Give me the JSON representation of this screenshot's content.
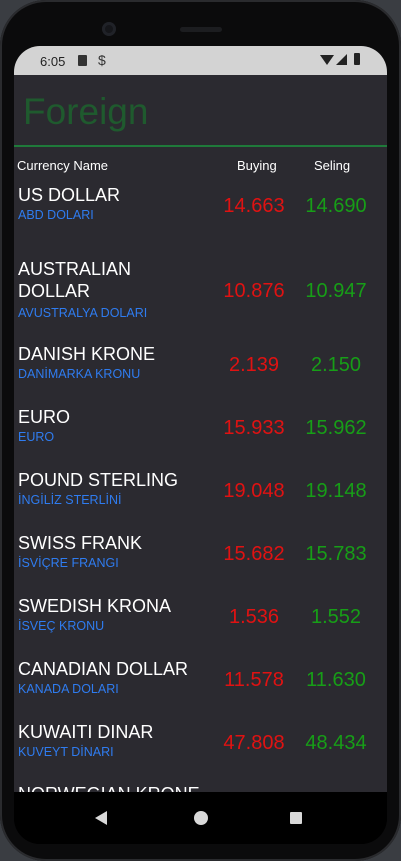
{
  "status": {
    "time": "6:05"
  },
  "app": {
    "title": "Foreign"
  },
  "columns": {
    "name": "Currency Name",
    "buying": "Buying",
    "selling": "Seling"
  },
  "currencies": [
    {
      "name": "US DOLLAR",
      "local_name": "ABD DOLARI",
      "buying": "14.663",
      "selling": "14.690"
    },
    {
      "name": "AUSTRALIAN DOLLAR",
      "local_name": "AVUSTRALYA DOLARI",
      "buying": "10.876",
      "selling": "10.947"
    },
    {
      "name": "DANISH KRONE",
      "local_name": "DANİMARKA KRONU",
      "buying": "2.139",
      "selling": "2.150"
    },
    {
      "name": "EURO",
      "local_name": "EURO",
      "buying": "15.933",
      "selling": "15.962"
    },
    {
      "name": "POUND STERLING",
      "local_name": "İNGİLİZ STERLİNİ",
      "buying": "19.048",
      "selling": "19.148"
    },
    {
      "name": "SWISS FRANK",
      "local_name": "İSVİÇRE FRANGI",
      "buying": "15.682",
      "selling": "15.783"
    },
    {
      "name": "SWEDISH KRONA",
      "local_name": "İSVEÇ KRONU",
      "buying": "1.536",
      "selling": "1.552"
    },
    {
      "name": "CANADIAN DOLLAR",
      "local_name": "KANADA DOLARI",
      "buying": "11.578",
      "selling": "11.630"
    },
    {
      "name": "KUWAITI DINAR",
      "local_name": "KUVEYT DİNARI",
      "buying": "47.808",
      "selling": "48.434"
    },
    {
      "name": "NORWEGIAN KRONE",
      "local_name": "",
      "buying": "",
      "selling": ""
    }
  ],
  "colors": {
    "buying": "#e01212",
    "selling": "#179e17",
    "subtitle": "#2f7cf0",
    "title": "#1f5a2e"
  },
  "icons": [
    "sim-card-icon",
    "sync-icon",
    "wifi-icon",
    "signal-icon",
    "battery-icon",
    "back-icon",
    "home-icon",
    "recents-icon"
  ]
}
